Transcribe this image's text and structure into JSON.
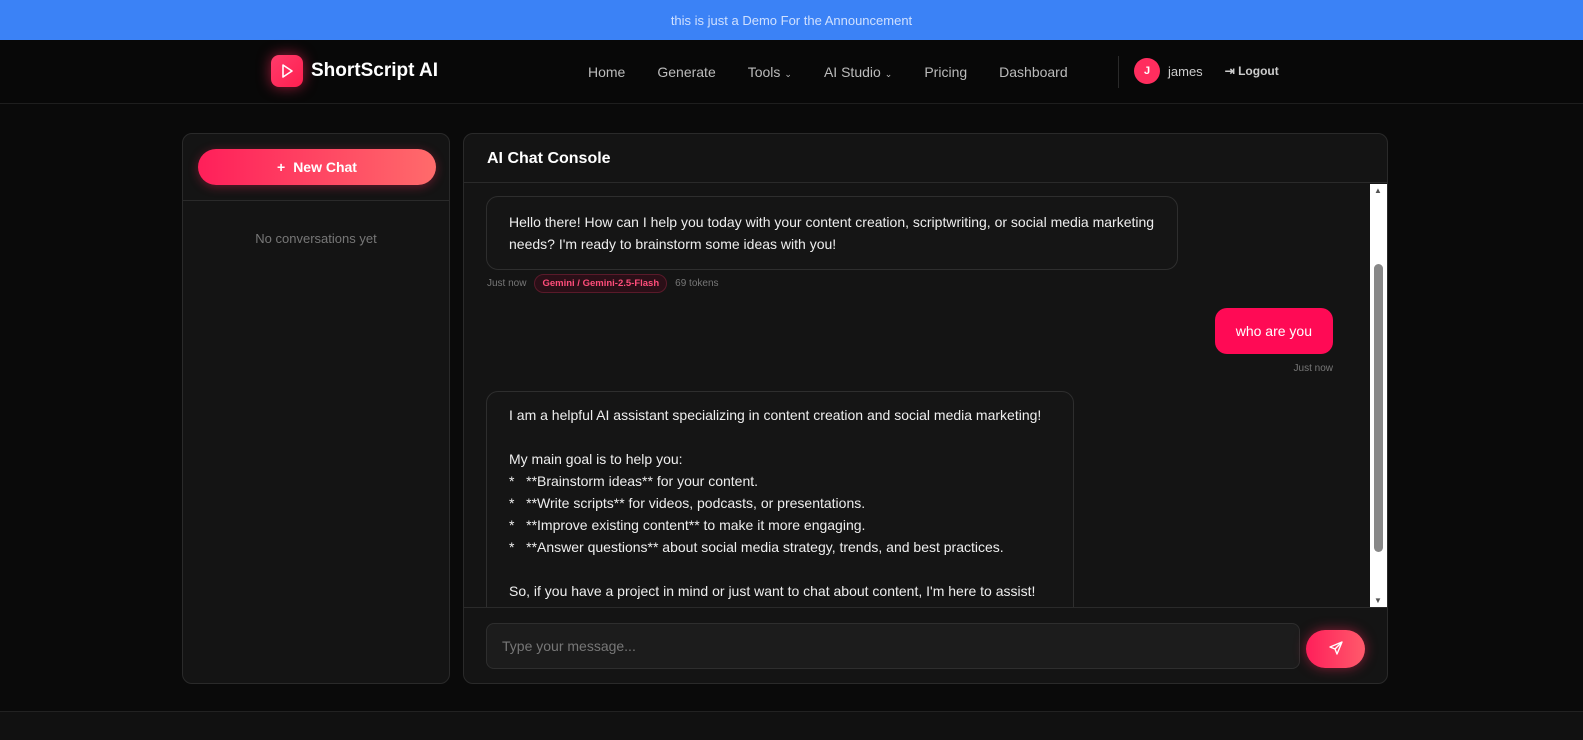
{
  "announcement": "this is just a Demo For the Announcement",
  "brand": "ShortScript AI",
  "nav": {
    "home": "Home",
    "generate": "Generate",
    "tools": "Tools",
    "ai_studio": "AI Studio",
    "pricing": "Pricing",
    "dashboard": "Dashboard",
    "chevron": "⌄"
  },
  "user": {
    "initial": "J",
    "name": "james",
    "logout": "Logout"
  },
  "sidebar": {
    "new_chat": "New Chat",
    "plus": "+",
    "empty": "No conversations yet"
  },
  "chat": {
    "title": "AI Chat Console",
    "messages": [
      {
        "role": "assistant",
        "text": "Hello there! How can I help you today with your content creation, scriptwriting, or social media marketing needs? I'm ready to brainstorm some ideas with you!",
        "time": "Just now",
        "model": "Gemini / Gemini-2.5-Flash",
        "tokens": "69 tokens"
      },
      {
        "role": "user",
        "text": "who are you",
        "time": "Just now"
      },
      {
        "role": "assistant",
        "lines": [
          "I am a helpful AI assistant specializing in content creation and social media marketing!",
          "",
          "My main goal is to help you:",
          "*   **Brainstorm ideas** for your content.",
          "*   **Write scripts** for videos, podcasts, or presentations.",
          "*   **Improve existing content** to make it more engaging.",
          "*   **Answer questions** about social media strategy, trends, and best practices.",
          "",
          "So, if you have a project in mind or just want to chat about content, I'm here to assist!"
        ]
      }
    ],
    "placeholder": "Type your message..."
  }
}
